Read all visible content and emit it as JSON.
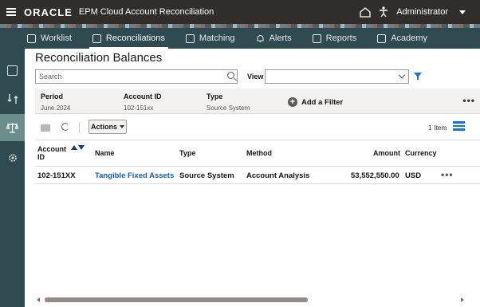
{
  "header": {
    "brand": "ORACLE",
    "app_title": "EPM Cloud Account Reconciliation",
    "user": "Administrator"
  },
  "nav": {
    "tabs": [
      {
        "label": "Worklist",
        "icon": "worklist-icon"
      },
      {
        "label": "Reconciliations",
        "icon": "reconciliations-icon",
        "active": true
      },
      {
        "label": "Matching",
        "icon": "matching-icon"
      },
      {
        "label": "Alerts",
        "icon": "bell-icon"
      },
      {
        "label": "Reports",
        "icon": "reports-icon"
      },
      {
        "label": "Academy",
        "icon": "academy-icon"
      }
    ]
  },
  "rail": {
    "items": [
      {
        "icon": "table-icon"
      },
      {
        "icon": "exchange-icon"
      },
      {
        "icon": "balance-scale-icon",
        "active": true
      },
      {
        "icon": "settings-cog-icon"
      }
    ]
  },
  "page": {
    "title": "Reconciliation Balances",
    "search_placeholder": "Search",
    "view_label": "View",
    "view_value": ""
  },
  "filters": {
    "period_label": "Period",
    "period_value": "June 2024",
    "account_label": "Account ID",
    "account_value": "102-151xx",
    "type_label": "Type",
    "type_value": "Source System",
    "add_filter_label": "Add a Filter"
  },
  "toolbar": {
    "actions_label": "Actions",
    "item_count": "1 Item"
  },
  "table": {
    "headers": {
      "account_line1": "Account",
      "account_line2": "ID",
      "name": "Name",
      "type": "Type",
      "method": "Method",
      "amount": "Amount",
      "currency": "Currency"
    },
    "rows": [
      {
        "account_id": "102-151XX",
        "name": "Tangible Fixed Assets",
        "type": "Source System",
        "method": "Account Analysis",
        "amount": "53,552,550.00",
        "currency": "USD"
      }
    ]
  },
  "colors": {
    "header_bg": "#312d2a",
    "nav_bg": "#2f4a50",
    "rail_active": "#6b8e8a",
    "link": "#1a5ea3",
    "accent": "#1a73c9"
  }
}
